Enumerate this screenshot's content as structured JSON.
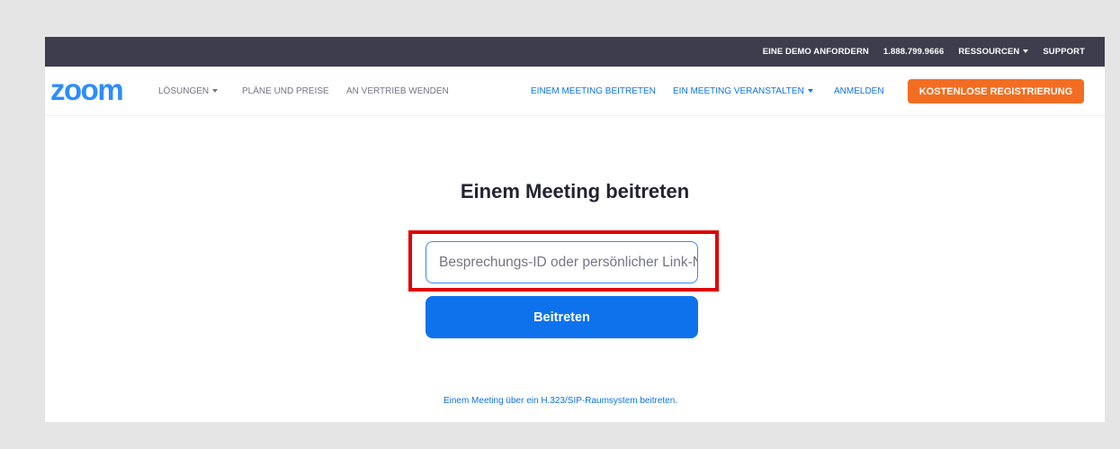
{
  "topbar": {
    "demo": "EINE DEMO ANFORDERN",
    "phone": "1.888.799.9666",
    "resources": "RESSOURCEN",
    "support": "SUPPORT"
  },
  "nav": {
    "logo": "zoom",
    "solutions": "LÖSUNGEN",
    "plans": "PLÄNE UND PREISE",
    "sales": "AN VERTRIEB WENDEN",
    "join": "EINEM MEETING BEITRETEN",
    "host": "EIN MEETING VERANSTALTEN",
    "signin": "ANMELDEN",
    "signup": "KOSTENLOSE REGISTRIERUNG"
  },
  "main": {
    "heading": "Einem Meeting beitreten",
    "input_placeholder": "Besprechungs-ID oder persönlicher Link-Name",
    "join_button": "Beitreten",
    "sip_link": "Einem Meeting über ein H.323/SIP-Raumsystem beitreten."
  },
  "colors": {
    "brand": "#2d8cff",
    "link": "#0e72ed",
    "signup": "#f26d21",
    "highlight": "#e00000",
    "topbar": "#3d3d4e"
  }
}
